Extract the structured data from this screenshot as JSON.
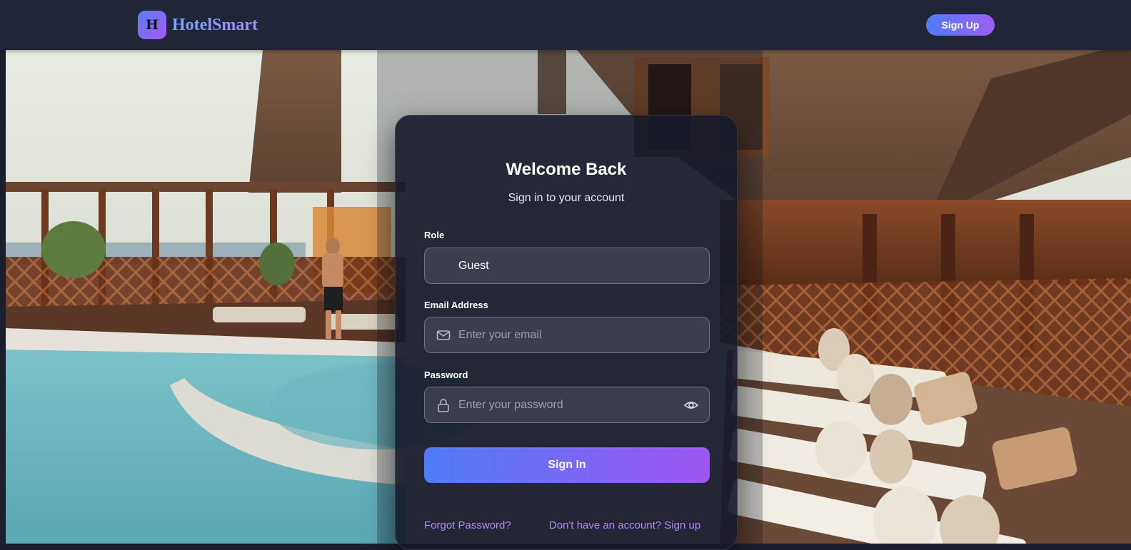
{
  "header": {
    "logo_letter": "H",
    "brand_name": "HotelSmart",
    "signup_label": "Sign Up"
  },
  "login": {
    "title": "Welcome Back",
    "subtitle": "Sign in to your account",
    "role": {
      "label": "Role",
      "selected_value": "Guest"
    },
    "email": {
      "label": "Email Address",
      "placeholder": "Enter your email",
      "icon": "mail-icon"
    },
    "password": {
      "label": "Password",
      "placeholder": "Enter your password",
      "icon": "lock-icon",
      "toggle_icon": "eye-icon"
    },
    "signin_label": "Sign In",
    "forgot_label": "Forgot Password?",
    "signup_prompt_label": "Don't have an account? Sign up"
  },
  "colors": {
    "accent_start": "#4f7cf7",
    "accent_end": "#9e55f2",
    "link": "#b388f5",
    "header_bg": "#202638",
    "card_bg": "#161a2a"
  }
}
